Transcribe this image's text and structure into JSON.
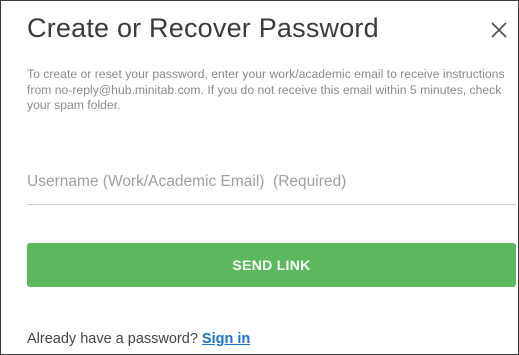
{
  "dialog": {
    "title": "Create or Recover Password",
    "close_icon": "close-icon",
    "description": "To create or reset your password, enter your work/academic email to receive instructions from no-reply@hub.minitab.com. If you do not receive this email within 5 minutes, check your spam folder."
  },
  "form": {
    "username_value": "",
    "username_placeholder": "Username (Work/Academic Email)  (Required)",
    "send_label": "SEND LINK"
  },
  "footer": {
    "prompt": "Already have a password?",
    "signin_label": "Sign in"
  },
  "colors": {
    "button_green": "#5cb85c",
    "link_blue": "#1a73c8",
    "title_text": "#3b3b3b",
    "description_text": "#8a8a8a"
  }
}
